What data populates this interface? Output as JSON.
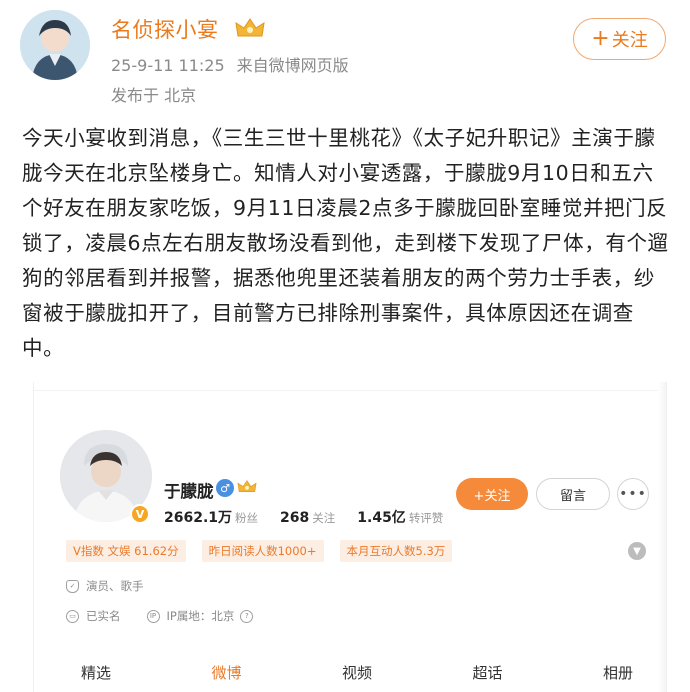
{
  "post": {
    "author_name": "名侦探小宴",
    "timestamp": "25-9-11 11:25",
    "source": "来自微博网页版",
    "location": "发布于 北京",
    "follow_label": "关注",
    "text": "今天小宴收到消息，《三生三世十里桃花》《太子妃升职记》主演于朦胧今天在北京坠楼身亡。知情人对小宴透露，于朦胧9月10日和五六个好友在朋友家吃饭，9月11日凌晨2点多于朦胧回卧室睡觉并把门反锁了，凌晨6点左右朋友散场没看到他，走到楼下发现了尸体，有个遛狗的邻居看到并报警，据悉他兜里还装着朋友的两个劳力士手表，纱窗被于朦胧扣开了，目前警方已排除刑事案件，具体原因还在调查中。"
  },
  "profile": {
    "name": "于朦胧",
    "followers_value": "2662.1万",
    "followers_label": "粉丝",
    "following_value": "268",
    "following_label": "关注",
    "reposts_value": "1.45亿",
    "reposts_label": "转评赞",
    "follow_label": "+关注",
    "message_label": "留言",
    "more_label": "•••",
    "tags": [
      "V指数 文娱 61.62分",
      "昨日阅读人数1000+",
      "本月互动人数5.3万"
    ],
    "occupation": "演员、歌手",
    "verified": "已实名",
    "ip_location": "IP属地：北京"
  },
  "tabs": [
    "精选",
    "微博",
    "视频",
    "超话",
    "相册"
  ],
  "active_tab": "微博",
  "colors": {
    "accent": "#ea7a1c",
    "follow_bg": "#f58a3a",
    "tag_bg": "#fdeee3",
    "muted": "#8a8a8a"
  }
}
